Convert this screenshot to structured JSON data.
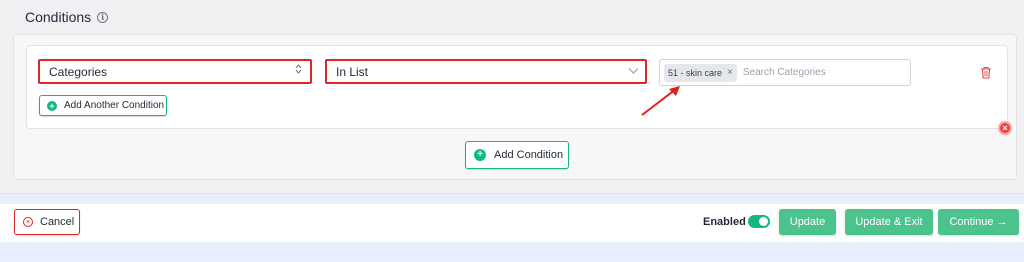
{
  "conditions": {
    "title": "Conditions",
    "info_glyph": "i",
    "rule": {
      "field_value": "Categories",
      "operator_value": "In List",
      "selected_tags": [
        {
          "label": "51 - skin care",
          "remove_glyph": "×"
        }
      ],
      "search_placeholder": "Search Categories"
    },
    "add_another_condition_label": "Add Another Condition",
    "add_condition_label": "Add Condition",
    "plus_glyph": "+",
    "remove_glyph": "×"
  },
  "footer": {
    "cancel_label": "Cancel",
    "cancel_glyph": "×",
    "enabled_label": "Enabled",
    "enabled": true,
    "update_label": "Update",
    "update_exit_label": "Update & Exit",
    "continue_label": "Continue →"
  },
  "colors": {
    "accent_green": "#4cc28d",
    "highlight_red": "#dc2626",
    "annotation_arrow": "#e11d1d"
  },
  "icons": {
    "info": "info-icon",
    "sort": "sort-arrows-icon",
    "chevron": "chevron-down-icon",
    "trash": "trash-icon",
    "remove": "close-circle-icon",
    "add": "plus-circle-icon",
    "cancel": "close-circle-icon"
  }
}
